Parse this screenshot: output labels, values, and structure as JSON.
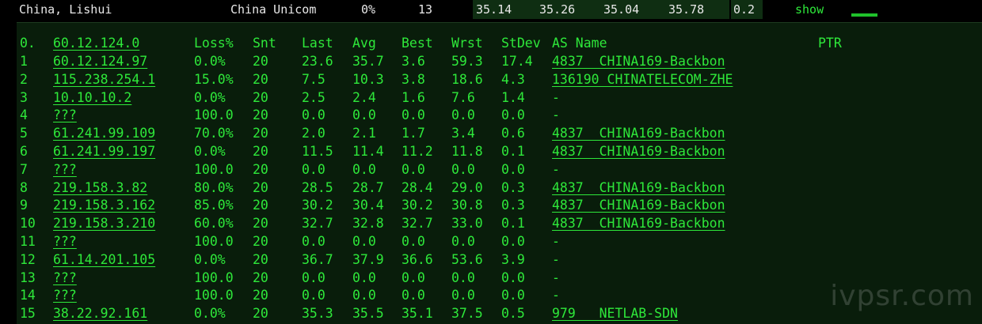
{
  "colors": {
    "terminal_bg": "#091d0b",
    "text": "#2ee83a",
    "header_text": "#e8e8e8",
    "highlight": "#0f2e12"
  },
  "topbar": {
    "location": "China, Lishui",
    "isp": "China Unicom",
    "loss": "0%",
    "sent": "13",
    "v1": "35.14",
    "v2": "35.26",
    "v3": "35.04",
    "v4": "35.78",
    "v5": "0.2",
    "show_label": "show"
  },
  "table": {
    "headers": {
      "idx": "0.",
      "host": "60.12.124.0",
      "loss": "Loss%",
      "snt": "Snt",
      "last": "Last",
      "avg": "Avg",
      "best": "Best",
      "wrst": "Wrst",
      "stdev": "StDev",
      "asname": "AS Name",
      "ptr": "PTR"
    },
    "rows": [
      {
        "idx": "1",
        "host": "60.12.124.97",
        "loss": "0.0%",
        "snt": "20",
        "last": "23.6",
        "avg": "35.7",
        "best": "3.6",
        "wrst": "59.3",
        "stdev": "17.4",
        "as": "4837  CHINA169-Backbon"
      },
      {
        "idx": "2",
        "host": "115.238.254.1",
        "loss": "15.0%",
        "snt": "20",
        "last": "7.5",
        "avg": "10.3",
        "best": "3.8",
        "wrst": "18.6",
        "stdev": "4.3",
        "as": "136190 CHINATELECOM-ZHE"
      },
      {
        "idx": "3",
        "host": "10.10.10.2",
        "loss": "0.0%",
        "snt": "20",
        "last": "2.5",
        "avg": "2.4",
        "best": "1.6",
        "wrst": "7.6",
        "stdev": "1.4",
        "as": "-"
      },
      {
        "idx": "4",
        "host": "???",
        "loss": "100.0",
        "snt": "20",
        "last": "0.0",
        "avg": "0.0",
        "best": "0.0",
        "wrst": "0.0",
        "stdev": "0.0",
        "as": "-"
      },
      {
        "idx": "5",
        "host": "61.241.99.109",
        "loss": "70.0%",
        "snt": "20",
        "last": "2.0",
        "avg": "2.1",
        "best": "1.7",
        "wrst": "3.4",
        "stdev": "0.6",
        "as": "4837  CHINA169-Backbon"
      },
      {
        "idx": "6",
        "host": "61.241.99.197",
        "loss": "0.0%",
        "snt": "20",
        "last": "11.5",
        "avg": "11.4",
        "best": "11.2",
        "wrst": "11.8",
        "stdev": "0.1",
        "as": "4837  CHINA169-Backbon"
      },
      {
        "idx": "7",
        "host": "???",
        "loss": "100.0",
        "snt": "20",
        "last": "0.0",
        "avg": "0.0",
        "best": "0.0",
        "wrst": "0.0",
        "stdev": "0.0",
        "as": "-"
      },
      {
        "idx": "8",
        "host": "219.158.3.82",
        "loss": "80.0%",
        "snt": "20",
        "last": "28.5",
        "avg": "28.7",
        "best": "28.4",
        "wrst": "29.0",
        "stdev": "0.3",
        "as": "4837  CHINA169-Backbon"
      },
      {
        "idx": "9",
        "host": "219.158.3.162",
        "loss": "85.0%",
        "snt": "20",
        "last": "30.2",
        "avg": "30.4",
        "best": "30.2",
        "wrst": "30.8",
        "stdev": "0.3",
        "as": "4837  CHINA169-Backbon"
      },
      {
        "idx": "10",
        "host": "219.158.3.210",
        "loss": "60.0%",
        "snt": "20",
        "last": "32.7",
        "avg": "32.8",
        "best": "32.7",
        "wrst": "33.0",
        "stdev": "0.1",
        "as": "4837  CHINA169-Backbon"
      },
      {
        "idx": "11",
        "host": "???",
        "loss": "100.0",
        "snt": "20",
        "last": "0.0",
        "avg": "0.0",
        "best": "0.0",
        "wrst": "0.0",
        "stdev": "0.0",
        "as": "-"
      },
      {
        "idx": "12",
        "host": "61.14.201.105",
        "loss": "0.0%",
        "snt": "20",
        "last": "36.7",
        "avg": "37.9",
        "best": "36.6",
        "wrst": "53.6",
        "stdev": "3.9",
        "as": "-"
      },
      {
        "idx": "13",
        "host": "???",
        "loss": "100.0",
        "snt": "20",
        "last": "0.0",
        "avg": "0.0",
        "best": "0.0",
        "wrst": "0.0",
        "stdev": "0.0",
        "as": "-"
      },
      {
        "idx": "14",
        "host": "???",
        "loss": "100.0",
        "snt": "20",
        "last": "0.0",
        "avg": "0.0",
        "best": "0.0",
        "wrst": "0.0",
        "stdev": "0.0",
        "as": "-"
      },
      {
        "idx": "15",
        "host": "38.22.92.161",
        "loss": "0.0%",
        "snt": "20",
        "last": "35.3",
        "avg": "35.5",
        "best": "35.1",
        "wrst": "37.5",
        "stdev": "0.5",
        "as": "979   NETLAB-SDN"
      }
    ]
  },
  "watermark": "ivpsr.com"
}
